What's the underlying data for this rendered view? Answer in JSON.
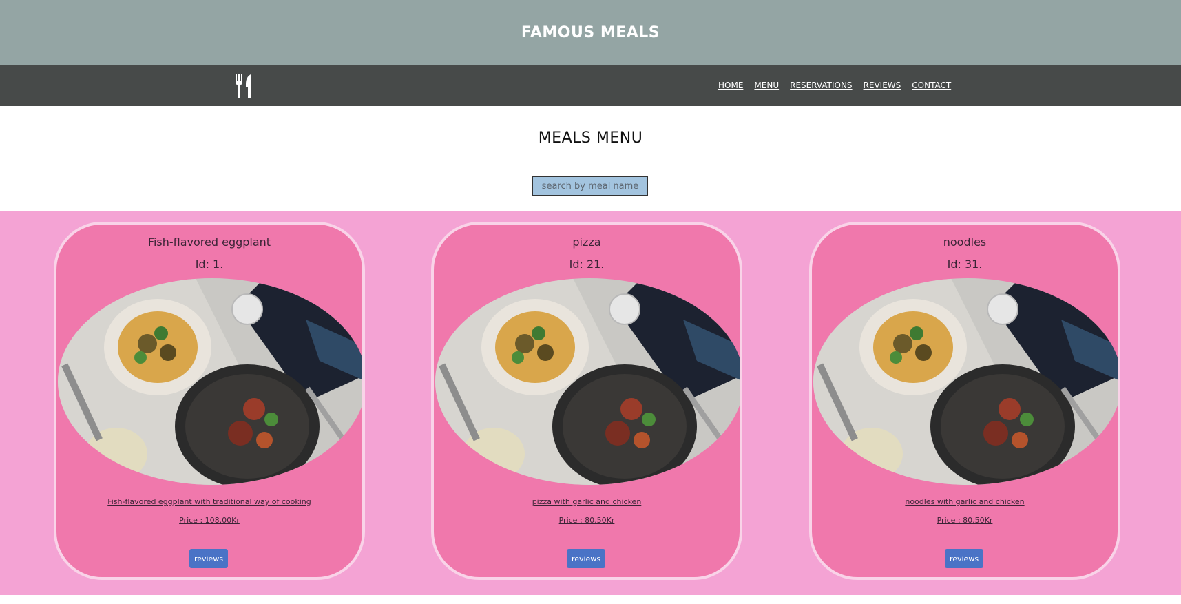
{
  "header": {
    "title": "FAMOUS MEALS"
  },
  "nav": {
    "logo_icon": "fork-knife-icon",
    "links": [
      {
        "label": "HOME"
      },
      {
        "label": "MENU"
      },
      {
        "label": "RESERVATIONS"
      },
      {
        "label": "REVIEWS"
      },
      {
        "label": "CONTACT"
      }
    ]
  },
  "main": {
    "heading": "MEALS MENU",
    "search": {
      "value": "",
      "placeholder": "search by meal name"
    }
  },
  "meals": [
    {
      "name": "Fish-flavored eggplant",
      "id_label": "Id: 1.",
      "image_icon": "plated-meal-photo",
      "description": "Fish-flavored eggplant with traditional way of cooking",
      "price": "Price : 108.00Kr",
      "button_label": "reviews"
    },
    {
      "name": "pizza",
      "id_label": "Id: 21.",
      "image_icon": "plated-meal-photo",
      "description": "pizza with garlic and chicken",
      "price": "Price : 80.50Kr",
      "button_label": "reviews"
    },
    {
      "name": "noodles",
      "id_label": "Id: 31.",
      "image_icon": "plated-meal-photo",
      "description": "noodles with garlic and chicken",
      "price": "Price : 80.50Kr",
      "button_label": "reviews"
    }
  ],
  "colors": {
    "banner": "#94a5a4",
    "navbar": "#474a49",
    "menu_background": "#f4a3d4",
    "card": "#f078ac",
    "card_border": "#f9d3e8",
    "button": "#4a73c6",
    "search_field": "#a3c4df"
  }
}
